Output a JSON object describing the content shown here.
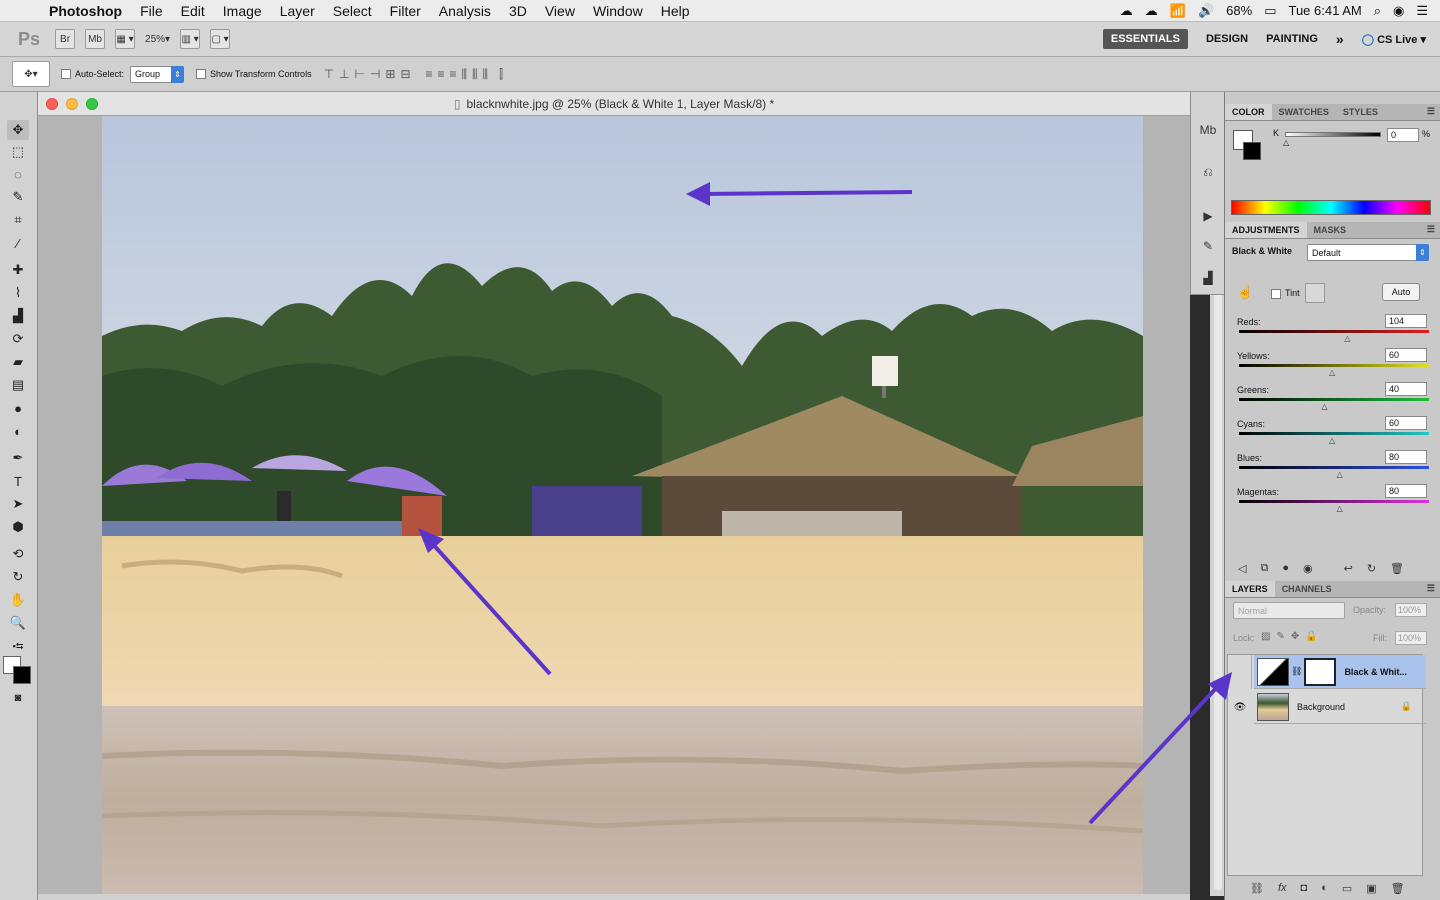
{
  "menubar": {
    "app_name": "Photoshop",
    "items": [
      "File",
      "Edit",
      "Image",
      "Layer",
      "Select",
      "Filter",
      "Analysis",
      "3D",
      "View",
      "Window",
      "Help"
    ],
    "battery": "68%",
    "clock": "Tue 6:41 AM"
  },
  "appbar": {
    "logo": "Ps",
    "bridge": "Br",
    "minibridge": "Mb",
    "zoom": "25%",
    "workspaces": [
      "ESSENTIALS",
      "DESIGN",
      "PAINTING"
    ],
    "more": "»",
    "cslive": "CS Live"
  },
  "options": {
    "autoselect_label": "Auto-Select:",
    "autoselect_value": "Group",
    "transform_label": "Show Transform Controls"
  },
  "document": {
    "title": "blacknwhite.jpg @ 25% (Black & White 1, Layer Mask/8) *"
  },
  "color_panel": {
    "tabs": [
      "COLOR",
      "SWATCHES",
      "STYLES"
    ],
    "k_label": "K",
    "k_value": "0",
    "percent": "%"
  },
  "adjustments": {
    "tabs": [
      "ADJUSTMENTS",
      "MASKS"
    ],
    "title": "Black & White",
    "preset": "Default",
    "tint": "Tint",
    "auto": "Auto",
    "sliders": [
      {
        "name": "Reds:",
        "value": "104",
        "level": 0.58
      },
      {
        "name": "Yellows:",
        "value": "60",
        "level": 0.5
      },
      {
        "name": "Greens:",
        "value": "40",
        "level": 0.46
      },
      {
        "name": "Cyans:",
        "value": "60",
        "level": 0.5
      },
      {
        "name": "Blues:",
        "value": "80",
        "level": 0.54
      },
      {
        "name": "Magentas:",
        "value": "80",
        "level": 0.54
      }
    ]
  },
  "layers": {
    "tabs": [
      "LAYERS",
      "CHANNELS"
    ],
    "blend": "Normal",
    "opacity_label": "Opacity:",
    "opacity": "100%",
    "lock_label": "Lock:",
    "fill_label": "Fill:",
    "fill": "100%",
    "items": [
      {
        "name": "Black & Whit...",
        "selected": true
      },
      {
        "name": "Background",
        "selected": false
      }
    ]
  },
  "colors": {
    "accent": "#3b7fd6",
    "arrow": "#5b35c9",
    "selected_layer": "#a9c3ec"
  }
}
